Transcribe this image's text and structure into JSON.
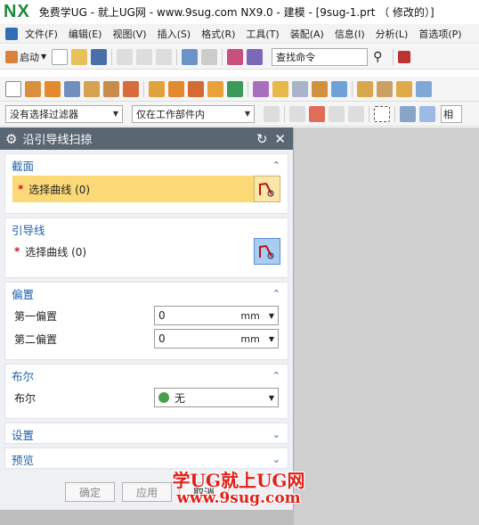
{
  "window": {
    "logo": "NX",
    "title": "免费学UG - 就上UG网 - www.9sug.com NX9.0 - 建模 - [9sug-1.prt （ 修改的）]"
  },
  "menubar": [
    "文件(F)",
    "编辑(E)",
    "视图(V)",
    "插入(S)",
    "格式(R)",
    "工具(T)",
    "装配(A)",
    "信息(I)",
    "分析(L)",
    "首选项(P)"
  ],
  "toolbar1": {
    "start_label": "启动",
    "search_placeholder": "查找命令"
  },
  "toolbar3": {
    "filter_value": "没有选择过滤器",
    "scope_value": "仅在工作部件内",
    "cut_label": "相"
  },
  "dialog": {
    "title": "沿引导线扫掠",
    "sections": {
      "section": {
        "label": "截面",
        "select_label": "选择曲线 (0)"
      },
      "guide": {
        "label": "引导线",
        "select_label": "选择曲线 (0)"
      },
      "offset": {
        "label": "偏置",
        "first_label": "第一偏置",
        "first_value": "0",
        "second_label": "第二偏置",
        "second_value": "0",
        "unit": "mm"
      },
      "boolean": {
        "label": "布尔",
        "field_label": "布尔",
        "value": "无"
      },
      "settings": {
        "label": "设置"
      },
      "preview": {
        "label": "预览"
      }
    },
    "buttons": {
      "ok": "确定",
      "apply": "应用",
      "cancel": "取消"
    }
  },
  "watermark": {
    "line1": "学UG就上UG网",
    "line2": "www.9sug.com"
  },
  "colors": {
    "accent": "#1f5fa8",
    "active_row": "#fcd977",
    "header": "#5a6672",
    "required": "#c8141a"
  }
}
